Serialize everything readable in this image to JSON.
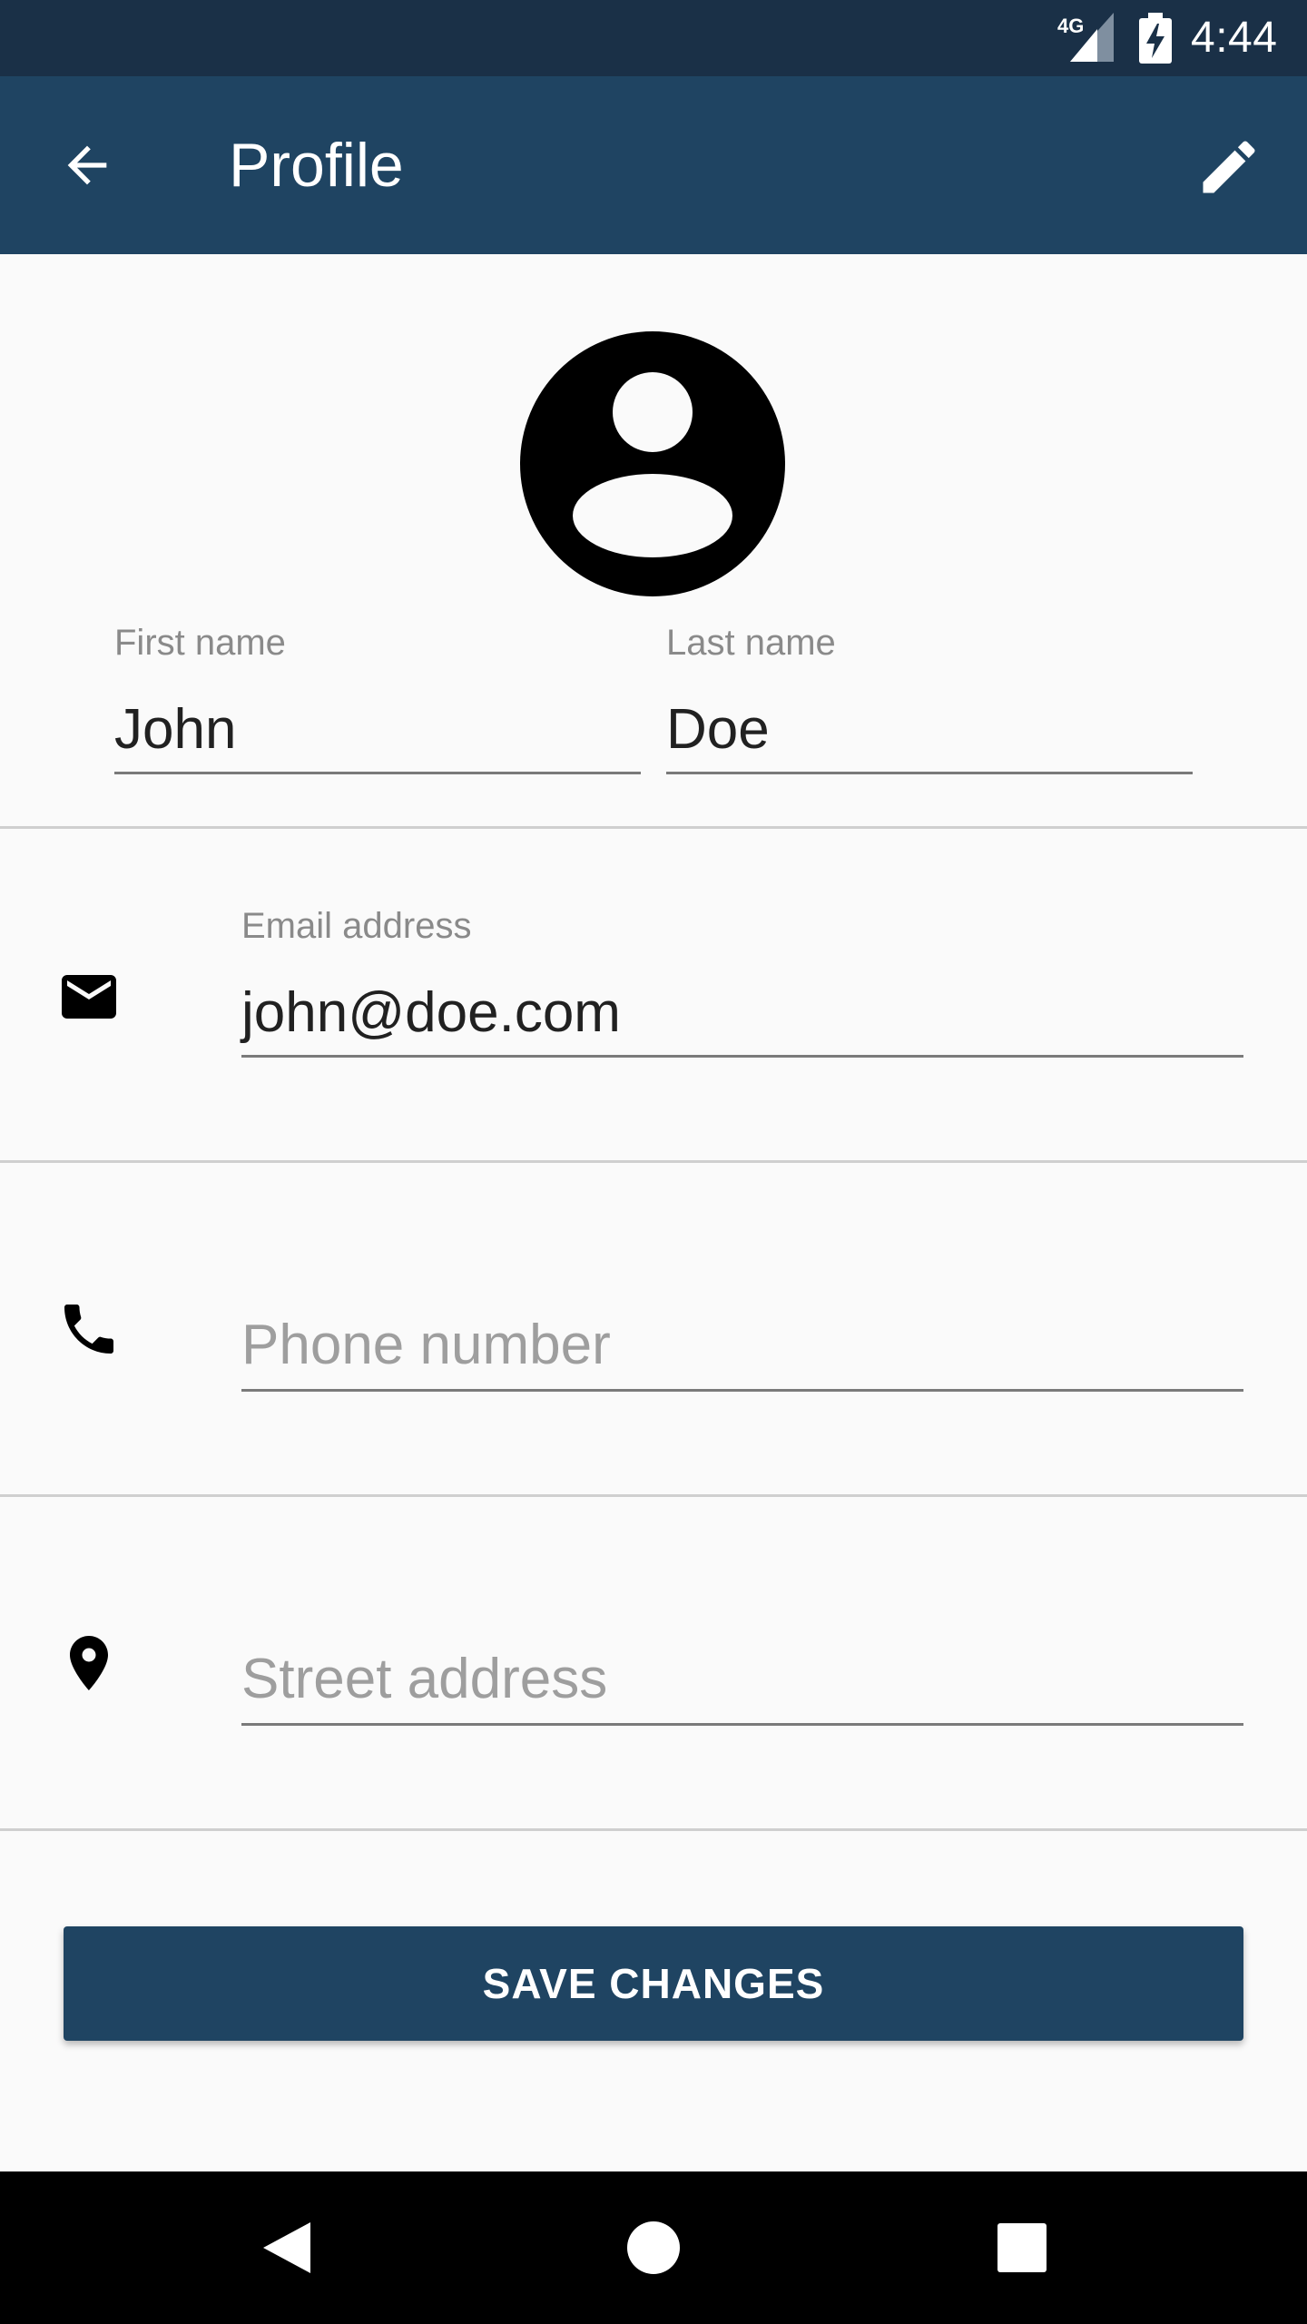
{
  "status_bar": {
    "network": "4G",
    "time": "4:44",
    "icons": [
      "signal-icon",
      "battery-charging-icon"
    ]
  },
  "app_bar": {
    "title": "Profile",
    "back_icon": "arrow-back-icon",
    "edit_icon": "edit-pencil-icon",
    "color": "#1f4462"
  },
  "avatar": {
    "icon": "account-circle-icon"
  },
  "form": {
    "first_name": {
      "label": "First name",
      "value": "John"
    },
    "last_name": {
      "label": "Last name",
      "value": "Doe"
    },
    "email": {
      "label": "Email address",
      "value": "john@doe.com",
      "icon": "email-icon"
    },
    "phone": {
      "placeholder": "Phone number",
      "value": "",
      "icon": "phone-icon"
    },
    "street": {
      "placeholder": "Street address",
      "value": "",
      "icon": "location-pin-icon"
    }
  },
  "save_button": {
    "label": "SAVE CHANGES",
    "color": "#1f4462"
  },
  "nav_bar": {
    "icons": [
      "nav-back-icon",
      "nav-home-icon",
      "nav-recents-icon"
    ]
  }
}
